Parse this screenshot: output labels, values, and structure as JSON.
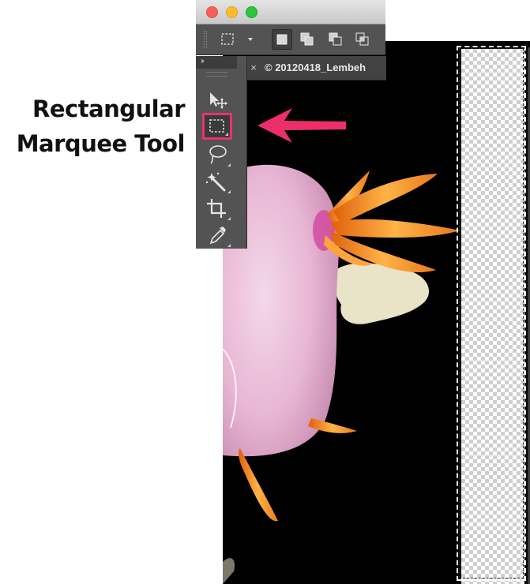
{
  "callout": {
    "line1": "Rectangular",
    "line2": "Marquee Tool"
  },
  "window": {
    "traffic_lights": [
      "red",
      "yellow",
      "green"
    ]
  },
  "options_bar": {
    "items": [
      "rectangular-marquee-preset-icon",
      "new-selection-icon",
      "add-to-selection-icon",
      "subtract-from-selection-icon",
      "intersect-with-selection-icon"
    ]
  },
  "document_tab": {
    "close_glyph": "×",
    "title": "© 20120418_Lembeh"
  },
  "tools_panel": {
    "collapse_glyph": "››",
    "tools": [
      "move-tool",
      "rectangular-marquee-tool",
      "lasso-tool",
      "magic-wand-tool",
      "crop-tool",
      "eyedropper-tool"
    ],
    "selected_tool": "rectangular-marquee-tool"
  },
  "colors": {
    "highlight": "#e8336e",
    "panel": "#535353",
    "canvas": "#000000"
  }
}
